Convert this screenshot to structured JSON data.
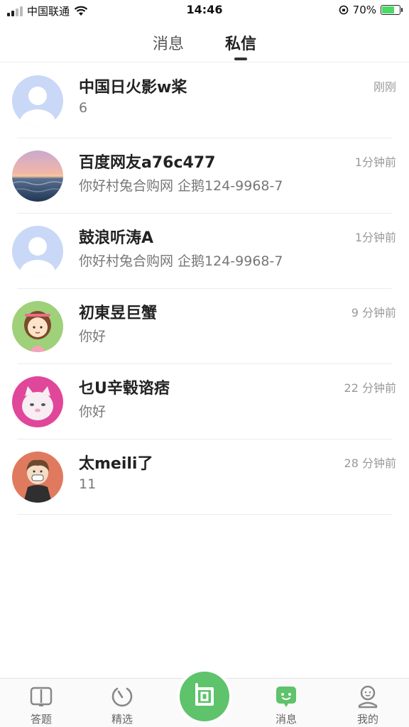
{
  "status": {
    "carrier": "中国联通",
    "time": "14:46",
    "battery": "70%",
    "battery_level": 0.7
  },
  "tabs": [
    {
      "label": "消息",
      "active": false
    },
    {
      "label": "私信",
      "active": true
    }
  ],
  "messages": [
    {
      "name": "中国日火影w桨",
      "preview": "6",
      "time": "刚刚",
      "avatar": "default-avatar"
    },
    {
      "name": "百度网友a76c477",
      "preview": "你好村兔合购网 企鹅124-9968-7",
      "time": "1分钟前",
      "avatar": "sunset-avatar"
    },
    {
      "name": "鼓浪听涛A",
      "preview": "你好村兔合购网 企鹅124-9968-7",
      "time": "1分钟前",
      "avatar": "default-avatar"
    },
    {
      "name": "初東昱巨蟹",
      "preview": "你好",
      "time": "9 分钟前",
      "avatar": "cartoon-girl-avatar"
    },
    {
      "name": "乜U辛毂谘痞",
      "preview": "你好",
      "time": "22 分钟前",
      "avatar": "cat-avatar"
    },
    {
      "name": "太meili了",
      "preview": "11",
      "time": "28 分钟前",
      "avatar": "anime-boy-avatar"
    }
  ],
  "nav": {
    "items": [
      {
        "label": "答题",
        "icon": "book-icon"
      },
      {
        "label": "精选",
        "icon": "spinner-icon"
      },
      {
        "label": "消息",
        "icon": "chat-icon",
        "active": true
      },
      {
        "label": "我的",
        "icon": "profile-icon"
      }
    ],
    "center_icon": "ask-icon"
  },
  "colors": {
    "accent": "#5ec36b",
    "default_avatar": "#c9d8f7",
    "divider": "#ececec"
  }
}
